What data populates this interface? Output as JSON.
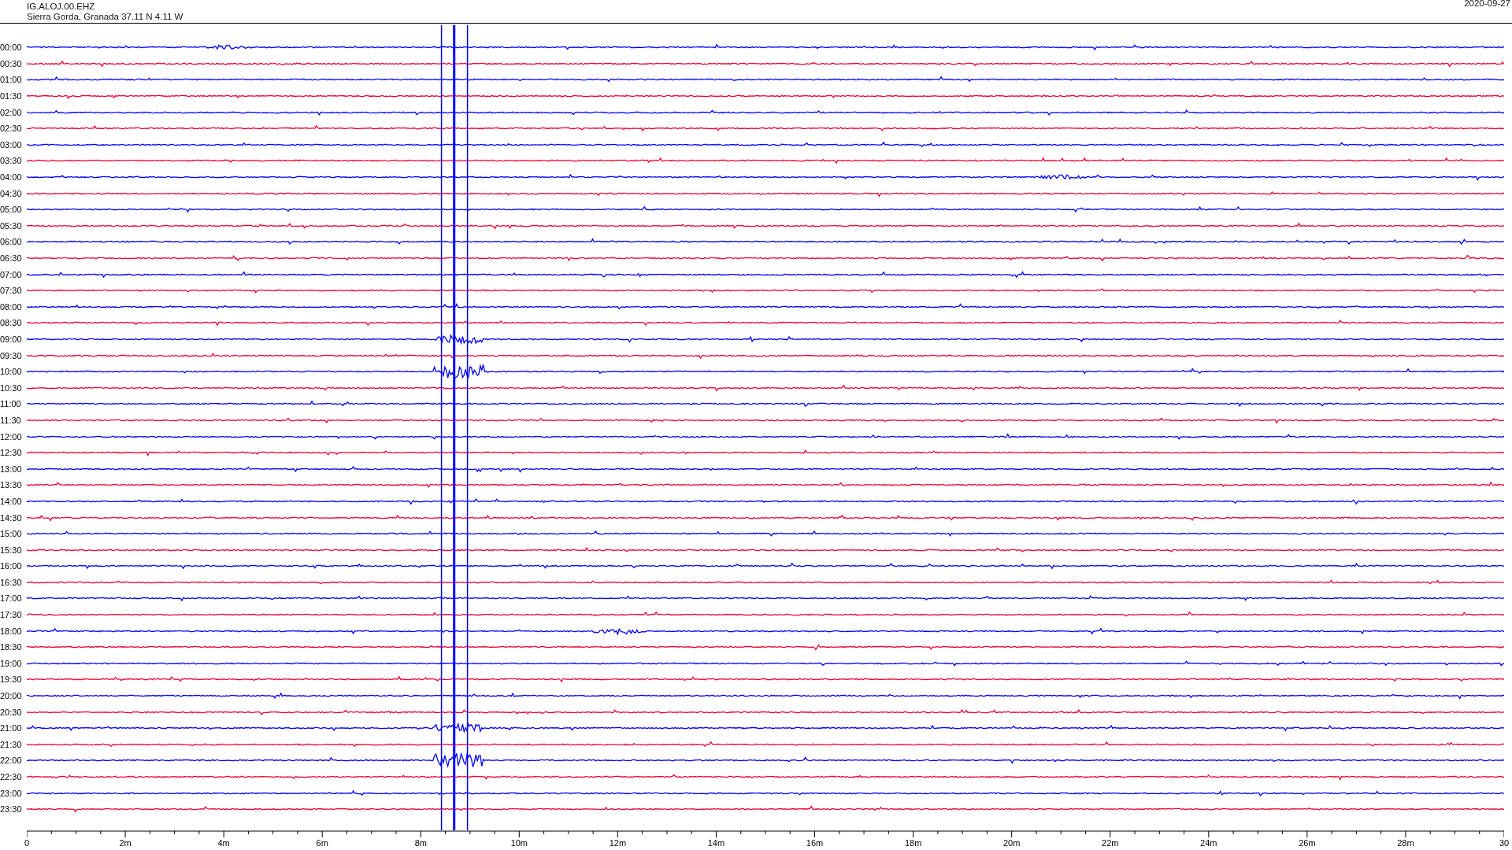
{
  "header": {
    "station": "IG.ALOJ.00.EHZ",
    "location": "Sierra Gorda, Granada  37.11 N 4.11 W",
    "date": "2020-09-27"
  },
  "rows": [
    {
      "label": "00:00",
      "color": "#0000ff"
    },
    {
      "label": "00:30",
      "color": "#f00033"
    },
    {
      "label": "01:00",
      "color": "#0000ff"
    },
    {
      "label": "01:30",
      "color": "#f00033"
    },
    {
      "label": "02:00",
      "color": "#0000ff"
    },
    {
      "label": "02:30",
      "color": "#f00033"
    },
    {
      "label": "03:00",
      "color": "#0000ff"
    },
    {
      "label": "03:30",
      "color": "#f00033"
    },
    {
      "label": "04:00",
      "color": "#0000ff"
    },
    {
      "label": "04:30",
      "color": "#f00033"
    },
    {
      "label": "05:00",
      "color": "#0000ff"
    },
    {
      "label": "05:30",
      "color": "#f00033"
    },
    {
      "label": "06:00",
      "color": "#0000ff"
    },
    {
      "label": "06:30",
      "color": "#f00033"
    },
    {
      "label": "07:00",
      "color": "#0000ff"
    },
    {
      "label": "07:30",
      "color": "#f00033"
    },
    {
      "label": "08:00",
      "color": "#0000ff"
    },
    {
      "label": "08:30",
      "color": "#f00033"
    },
    {
      "label": "09:00",
      "color": "#0000ff"
    },
    {
      "label": "09:30",
      "color": "#f00033"
    },
    {
      "label": "10:00",
      "color": "#0000ff"
    },
    {
      "label": "10:30",
      "color": "#f00033"
    },
    {
      "label": "11:00",
      "color": "#0000ff"
    },
    {
      "label": "11:30",
      "color": "#f00033"
    },
    {
      "label": "12:00",
      "color": "#0000ff"
    },
    {
      "label": "12:30",
      "color": "#f00033"
    },
    {
      "label": "13:00",
      "color": "#0000ff"
    },
    {
      "label": "13:30",
      "color": "#f00033"
    },
    {
      "label": "14:00",
      "color": "#0000ff"
    },
    {
      "label": "14:30",
      "color": "#f00033"
    },
    {
      "label": "15:00",
      "color": "#0000ff"
    },
    {
      "label": "15:30",
      "color": "#f00033"
    },
    {
      "label": "16:00",
      "color": "#0000ff"
    },
    {
      "label": "16:30",
      "color": "#f00033"
    },
    {
      "label": "17:00",
      "color": "#0000ff"
    },
    {
      "label": "17:30",
      "color": "#f00033"
    },
    {
      "label": "18:00",
      "color": "#0000ff"
    },
    {
      "label": "18:30",
      "color": "#f00033"
    },
    {
      "label": "19:00",
      "color": "#0000ff"
    },
    {
      "label": "19:30",
      "color": "#f00033"
    },
    {
      "label": "20:00",
      "color": "#0000ff"
    },
    {
      "label": "20:30",
      "color": "#f00033"
    },
    {
      "label": "21:00",
      "color": "#0000ff"
    },
    {
      "label": "21:30",
      "color": "#f00033"
    },
    {
      "label": "22:00",
      "color": "#0000ff"
    },
    {
      "label": "22:30",
      "color": "#f00033"
    },
    {
      "label": "23:00",
      "color": "#0000ff"
    },
    {
      "label": "23:30",
      "color": "#f00033"
    }
  ],
  "x_axis": {
    "ticks": [
      "0",
      "2m",
      "4m",
      "6m",
      "8m",
      "10m",
      "12m",
      "14m",
      "16m",
      "18m",
      "20m",
      "22m",
      "24m",
      "26m",
      "28m",
      "30"
    ]
  }
}
